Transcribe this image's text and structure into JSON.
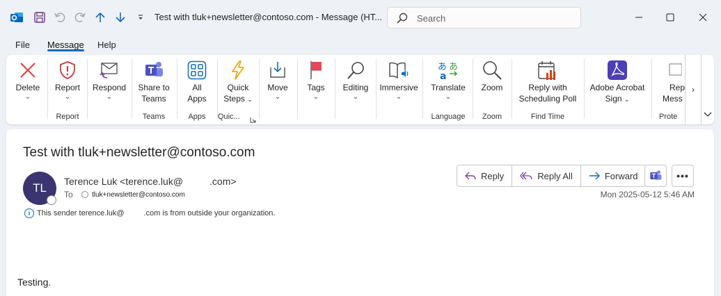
{
  "window": {
    "title": "Test with tluk+newsletter@contoso.com  -  Message (HT...",
    "search_placeholder": "Search"
  },
  "menu": [
    "File",
    "Message",
    "Help"
  ],
  "ribbon": {
    "buttons": {
      "delete": "Delete",
      "report": "Report",
      "respond": "Respond",
      "share_teams_1": "Share to",
      "share_teams_2": "Teams",
      "all_apps_1": "All",
      "all_apps_2": "Apps",
      "quick_steps_1": "Quick",
      "quick_steps_2": "Steps",
      "move": "Move",
      "tags": "Tags",
      "editing": "Editing",
      "immersive": "Immersive",
      "translate": "Translate",
      "zoom": "Zoom",
      "reply_poll_1": "Reply with",
      "reply_poll_2": "Scheduling Poll",
      "adobe_1": "Adobe Acrobat",
      "adobe_2": "Sign",
      "partial_1": "Rep",
      "partial_2": "Mess"
    },
    "groups": {
      "report": "Report",
      "teams": "Teams",
      "apps": "Apps",
      "quick": "Quic...",
      "language": "Language",
      "zoom": "Zoom",
      "find_time": "Find Time",
      "protect": "Prote"
    }
  },
  "message": {
    "subject": "Test with tluk+newsletter@contoso.com",
    "avatar_initials": "TL",
    "sender_name": "Terence Luk <terence.luk@",
    "sender_domain": ".com>",
    "to_label": "To",
    "to_address": "tluk+newsletter@contoso.com",
    "info_text": "This sender terence.luk@",
    "info_text_2": ".com is from outside your organization.",
    "actions": {
      "reply": "Reply",
      "reply_all": "Reply All",
      "forward": "Forward"
    },
    "date": "Mon 2025-05-12 5:46 AM",
    "body": "Testing."
  }
}
